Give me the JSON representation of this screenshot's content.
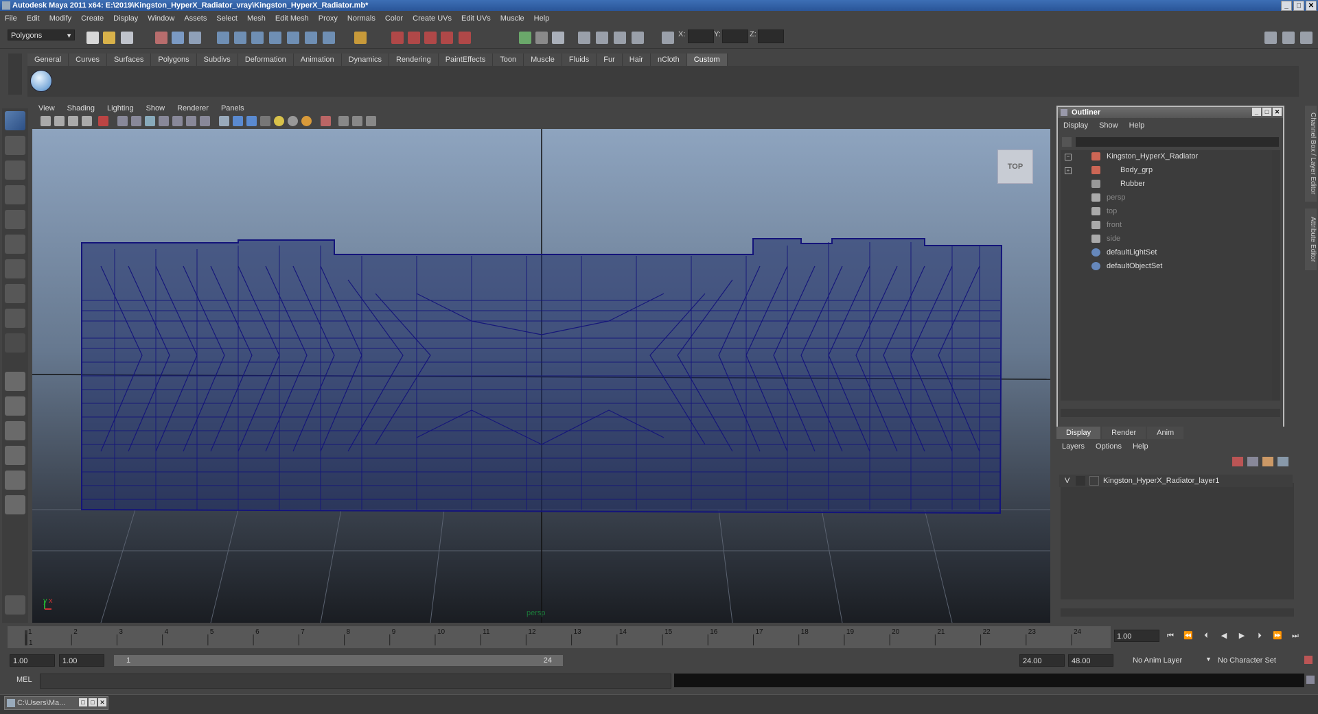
{
  "window": {
    "title": "Autodesk Maya 2011 x64: E:\\2019\\Kingston_HyperX_Radiator_vray\\Kingston_HyperX_Radiator.mb*"
  },
  "menubar": [
    "File",
    "Edit",
    "Modify",
    "Create",
    "Display",
    "Window",
    "Assets",
    "Select",
    "Mesh",
    "Edit Mesh",
    "Proxy",
    "Normals",
    "Color",
    "Create UVs",
    "Edit UVs",
    "Muscle",
    "Help"
  ],
  "toolbar": {
    "mode": "Polygons",
    "x_label": "X:",
    "y_label": "Y:",
    "z_label": "Z:"
  },
  "shelf": {
    "tabs": [
      "General",
      "Curves",
      "Surfaces",
      "Polygons",
      "Subdivs",
      "Deformation",
      "Animation",
      "Dynamics",
      "Rendering",
      "PaintEffects",
      "Toon",
      "Muscle",
      "Fluids",
      "Fur",
      "Hair",
      "nCloth",
      "Custom"
    ],
    "active": "Custom"
  },
  "viewport": {
    "menu": [
      "View",
      "Shading",
      "Lighting",
      "Show",
      "Renderer",
      "Panels"
    ],
    "view_cube": "TOP",
    "camera_label": "persp",
    "axis_y": "y",
    "axis_x": "x",
    "wire_color": "#14147a"
  },
  "outliner": {
    "title": "Outliner",
    "menu": [
      "Display",
      "Show",
      "Help"
    ],
    "items": [
      {
        "label": "Kingston_HyperX_Radiator",
        "dim": false
      },
      {
        "label": "Body_grp",
        "dim": false
      },
      {
        "label": "Rubber",
        "dim": false
      },
      {
        "label": "persp",
        "dim": true
      },
      {
        "label": "top",
        "dim": true
      },
      {
        "label": "front",
        "dim": true
      },
      {
        "label": "side",
        "dim": true
      },
      {
        "label": "defaultLightSet",
        "dim": false
      },
      {
        "label": "defaultObjectSet",
        "dim": false
      }
    ]
  },
  "layers": {
    "tabs": [
      "Display",
      "Render",
      "Anim"
    ],
    "active": "Display",
    "menu": [
      "Layers",
      "Options",
      "Help"
    ],
    "visible_flag": "V",
    "layer_name": "Kingston_HyperX_Radiator_layer1"
  },
  "sidetabs": [
    "Channel Box / Layer Editor",
    "Attribute Editor"
  ],
  "timeline": {
    "ticks": [
      1,
      2,
      3,
      4,
      5,
      6,
      7,
      8,
      9,
      10,
      11,
      12,
      13,
      14,
      15,
      16,
      17,
      18,
      19,
      20,
      21,
      22,
      23,
      24
    ],
    "start_label": "1",
    "current_frame": "1.00"
  },
  "range": {
    "start": "1.00",
    "start2": "1.00",
    "bar_left": "1",
    "bar_right": "24",
    "end": "24.00",
    "end2": "48.00",
    "anim_layer": "No Anim Layer",
    "char_set": "No Character Set"
  },
  "cmdline": {
    "label": "MEL"
  },
  "taskbar": {
    "item": "C:\\Users\\Ma..."
  }
}
